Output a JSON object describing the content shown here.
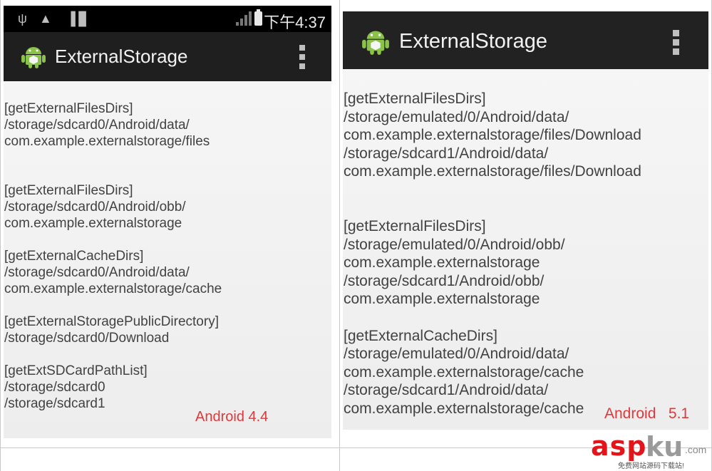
{
  "left": {
    "status": {
      "time": "下午4:37"
    },
    "app_title": "ExternalStorage",
    "blocks": [
      {
        "lines": [
          "[getExternalFilesDirs]",
          "/storage/sdcard0/Android/data/",
          "com.example.externalstorage/files"
        ]
      },
      {
        "lines": [
          "[getExternalFilesDirs]",
          "/storage/sdcard0/Android/obb/",
          "com.example.externalstorage"
        ]
      },
      {
        "lines": [
          "[getExternalCacheDirs]",
          "/storage/sdcard0/Android/data/",
          "com.example.externalstorage/cache"
        ]
      },
      {
        "lines": [
          "[getExternalStoragePublicDirectory]",
          "/storage/sdcard0/Download"
        ]
      },
      {
        "lines": [
          "[getExtSDCardPathList]",
          "/storage/sdcard0",
          "/storage/sdcard1"
        ]
      }
    ],
    "version_label": "Android 4.4"
  },
  "right": {
    "app_title": "ExternalStorage",
    "blocks": [
      {
        "lines": [
          "[getExternalFilesDirs]",
          "/storage/emulated/0/Android/data/",
          "com.example.externalstorage/files/Download",
          "/storage/sdcard1/Android/data/",
          "com.example.externalstorage/files/Download"
        ]
      },
      {
        "lines": [
          "[getExternalFilesDirs]",
          "/storage/emulated/0/Android/obb/",
          "com.example.externalstorage",
          "/storage/sdcard1/Android/obb/",
          "com.example.externalstorage"
        ]
      },
      {
        "lines": [
          "[getExternalCacheDirs]",
          "/storage/emulated/0/Android/data/",
          "com.example.externalstorage/cache",
          "/storage/sdcard1/Android/data/",
          "com.example.externalstorage/cache"
        ]
      }
    ],
    "version_label": "Android   5.1"
  },
  "watermark": {
    "text_main": "asp",
    "text_ku": "ku",
    "text_com": ".com",
    "text_sub": "免费网站源码下载站!"
  },
  "colors": {
    "statusbar": "#000000",
    "actionbar": "#1f1f1f",
    "content_bg": "#efefef",
    "text": "#424242",
    "version_red": "#e0393b",
    "watermark_red": "#e4141b"
  },
  "icons": [
    "usb-icon",
    "warning-icon",
    "sd-card-icon",
    "no-signal-icon",
    "battery-icon",
    "android-logo-icon",
    "overflow-menu-icon"
  ]
}
